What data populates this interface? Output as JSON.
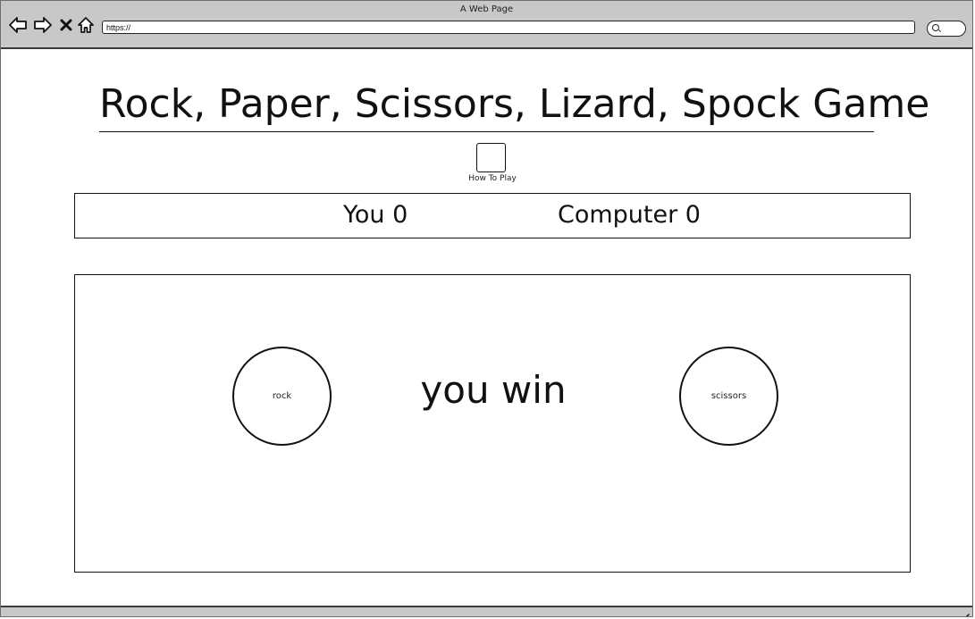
{
  "browser": {
    "window_title": "A Web Page",
    "url": "https://",
    "icons": {
      "back": "back-arrow-icon",
      "forward": "forward-arrow-icon",
      "stop": "close-icon",
      "home": "home-icon",
      "search": "search-icon",
      "resize": "resize-grip-icon"
    }
  },
  "page": {
    "title": "Rock, Paper, Scissors, Lizard, Spock Game",
    "how_to_play": {
      "label": "How To Play"
    }
  },
  "scoreboard": {
    "player": "You 0",
    "computer": "Computer 0"
  },
  "game": {
    "player_choice": "rock",
    "computer_choice": "scissors",
    "result": "you win"
  }
}
